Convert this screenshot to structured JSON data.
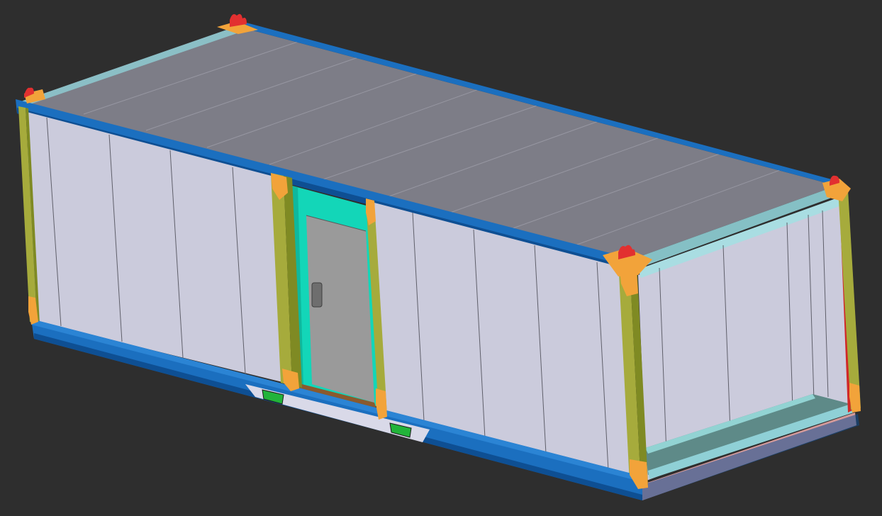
{
  "viewport": {
    "background": "#2e2e2e",
    "view": "isometric"
  },
  "model": {
    "type": "modular container",
    "colors": {
      "roof": "#7d7d87",
      "roof_seam": "#9a9aa5",
      "roof_trim_blue": "#1b6fbf",
      "roof_trim_dark": "#0e4f93",
      "roof_trim_cyan": "#8fd0d6",
      "wall_panel": "#cbcbdc",
      "wall_panel_dark": "#c1c1d3",
      "panel_line": "#5f5f6a",
      "frame_post": "#a6ab3c",
      "frame_post_dark": "#7f8a23",
      "corner_bracket": "#f2a33a",
      "lifting_lug": "#e23030",
      "base_blue": "#1b6fbf",
      "base_blue_dark": "#0e4f93",
      "door_frame": "#13d6b8",
      "door_leaf": "#9a9a9a",
      "door_handle": "#6e6e6e",
      "threshold": "#8a5a2e",
      "forklift_pocket": "#22b33a",
      "skid": "#d9d9e8",
      "open_end_floor": "#5e8a88",
      "open_end_floor_edge": "#92d3d3",
      "end_base_pink": "#d49a9a",
      "end_red_edge": "#d02828"
    },
    "icons": {
      "lifting_lug": "lifting-lug-icon",
      "corner_bracket": "corner-bracket-icon",
      "door_handle": "door-handle-icon",
      "forklift_pocket": "forklift-pocket-icon"
    }
  }
}
